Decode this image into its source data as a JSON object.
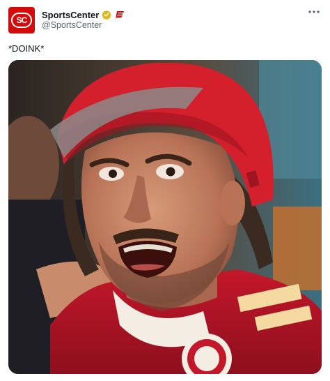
{
  "account": {
    "display_name": "SportsCenter",
    "handle": "@SportsCenter",
    "avatar_text": "SC"
  },
  "tweet": {
    "text": "*DOINK*"
  },
  "icons": {
    "verified": "verified-badge-icon",
    "affiliate": "espn-affiliate-icon",
    "more": "more-options-icon"
  },
  "colors": {
    "brand_red": "#d50a0a",
    "verified_gold": "#e2b719",
    "text_primary": "#0f1419",
    "text_secondary": "#536471"
  }
}
